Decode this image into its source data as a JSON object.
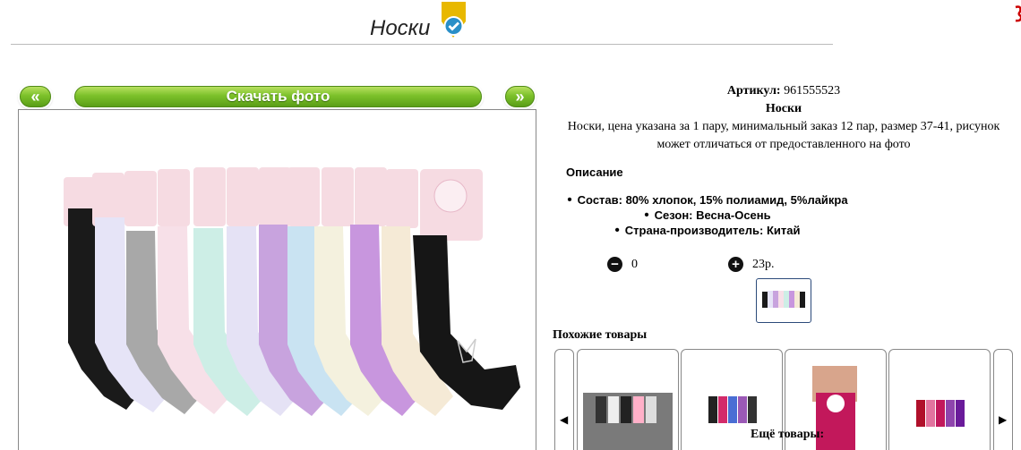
{
  "header": {
    "title": "Носки",
    "badge_icon": "check-badge-icon"
  },
  "gallery": {
    "prev_label": "«",
    "next_label": "»",
    "download_label": "Скачать фото"
  },
  "product": {
    "sku_label": "Артикул:",
    "sku_value": "961555523",
    "name": "Носки",
    "description": "Носки, цена указана за 1 пару, минимальный заказ 12 пар, размер 37-41, рисунок может отличаться от предоставленного на фото",
    "section_heading": "Описание",
    "specs": [
      "Состав: 80% хлопок, 15% полиамид, 5%лайкра",
      "Сезон: Весна-Осень",
      "Страна-производитель: Китай"
    ],
    "quantity": "0",
    "price": "23р."
  },
  "similar": {
    "heading": "Похожие товары",
    "prev_icon": "◀",
    "next_icon": "▶"
  },
  "more": {
    "heading": "Ещё товары:"
  },
  "colors": {
    "button_green": "#7cc12a",
    "thumb_border": "#2c4a7a"
  }
}
